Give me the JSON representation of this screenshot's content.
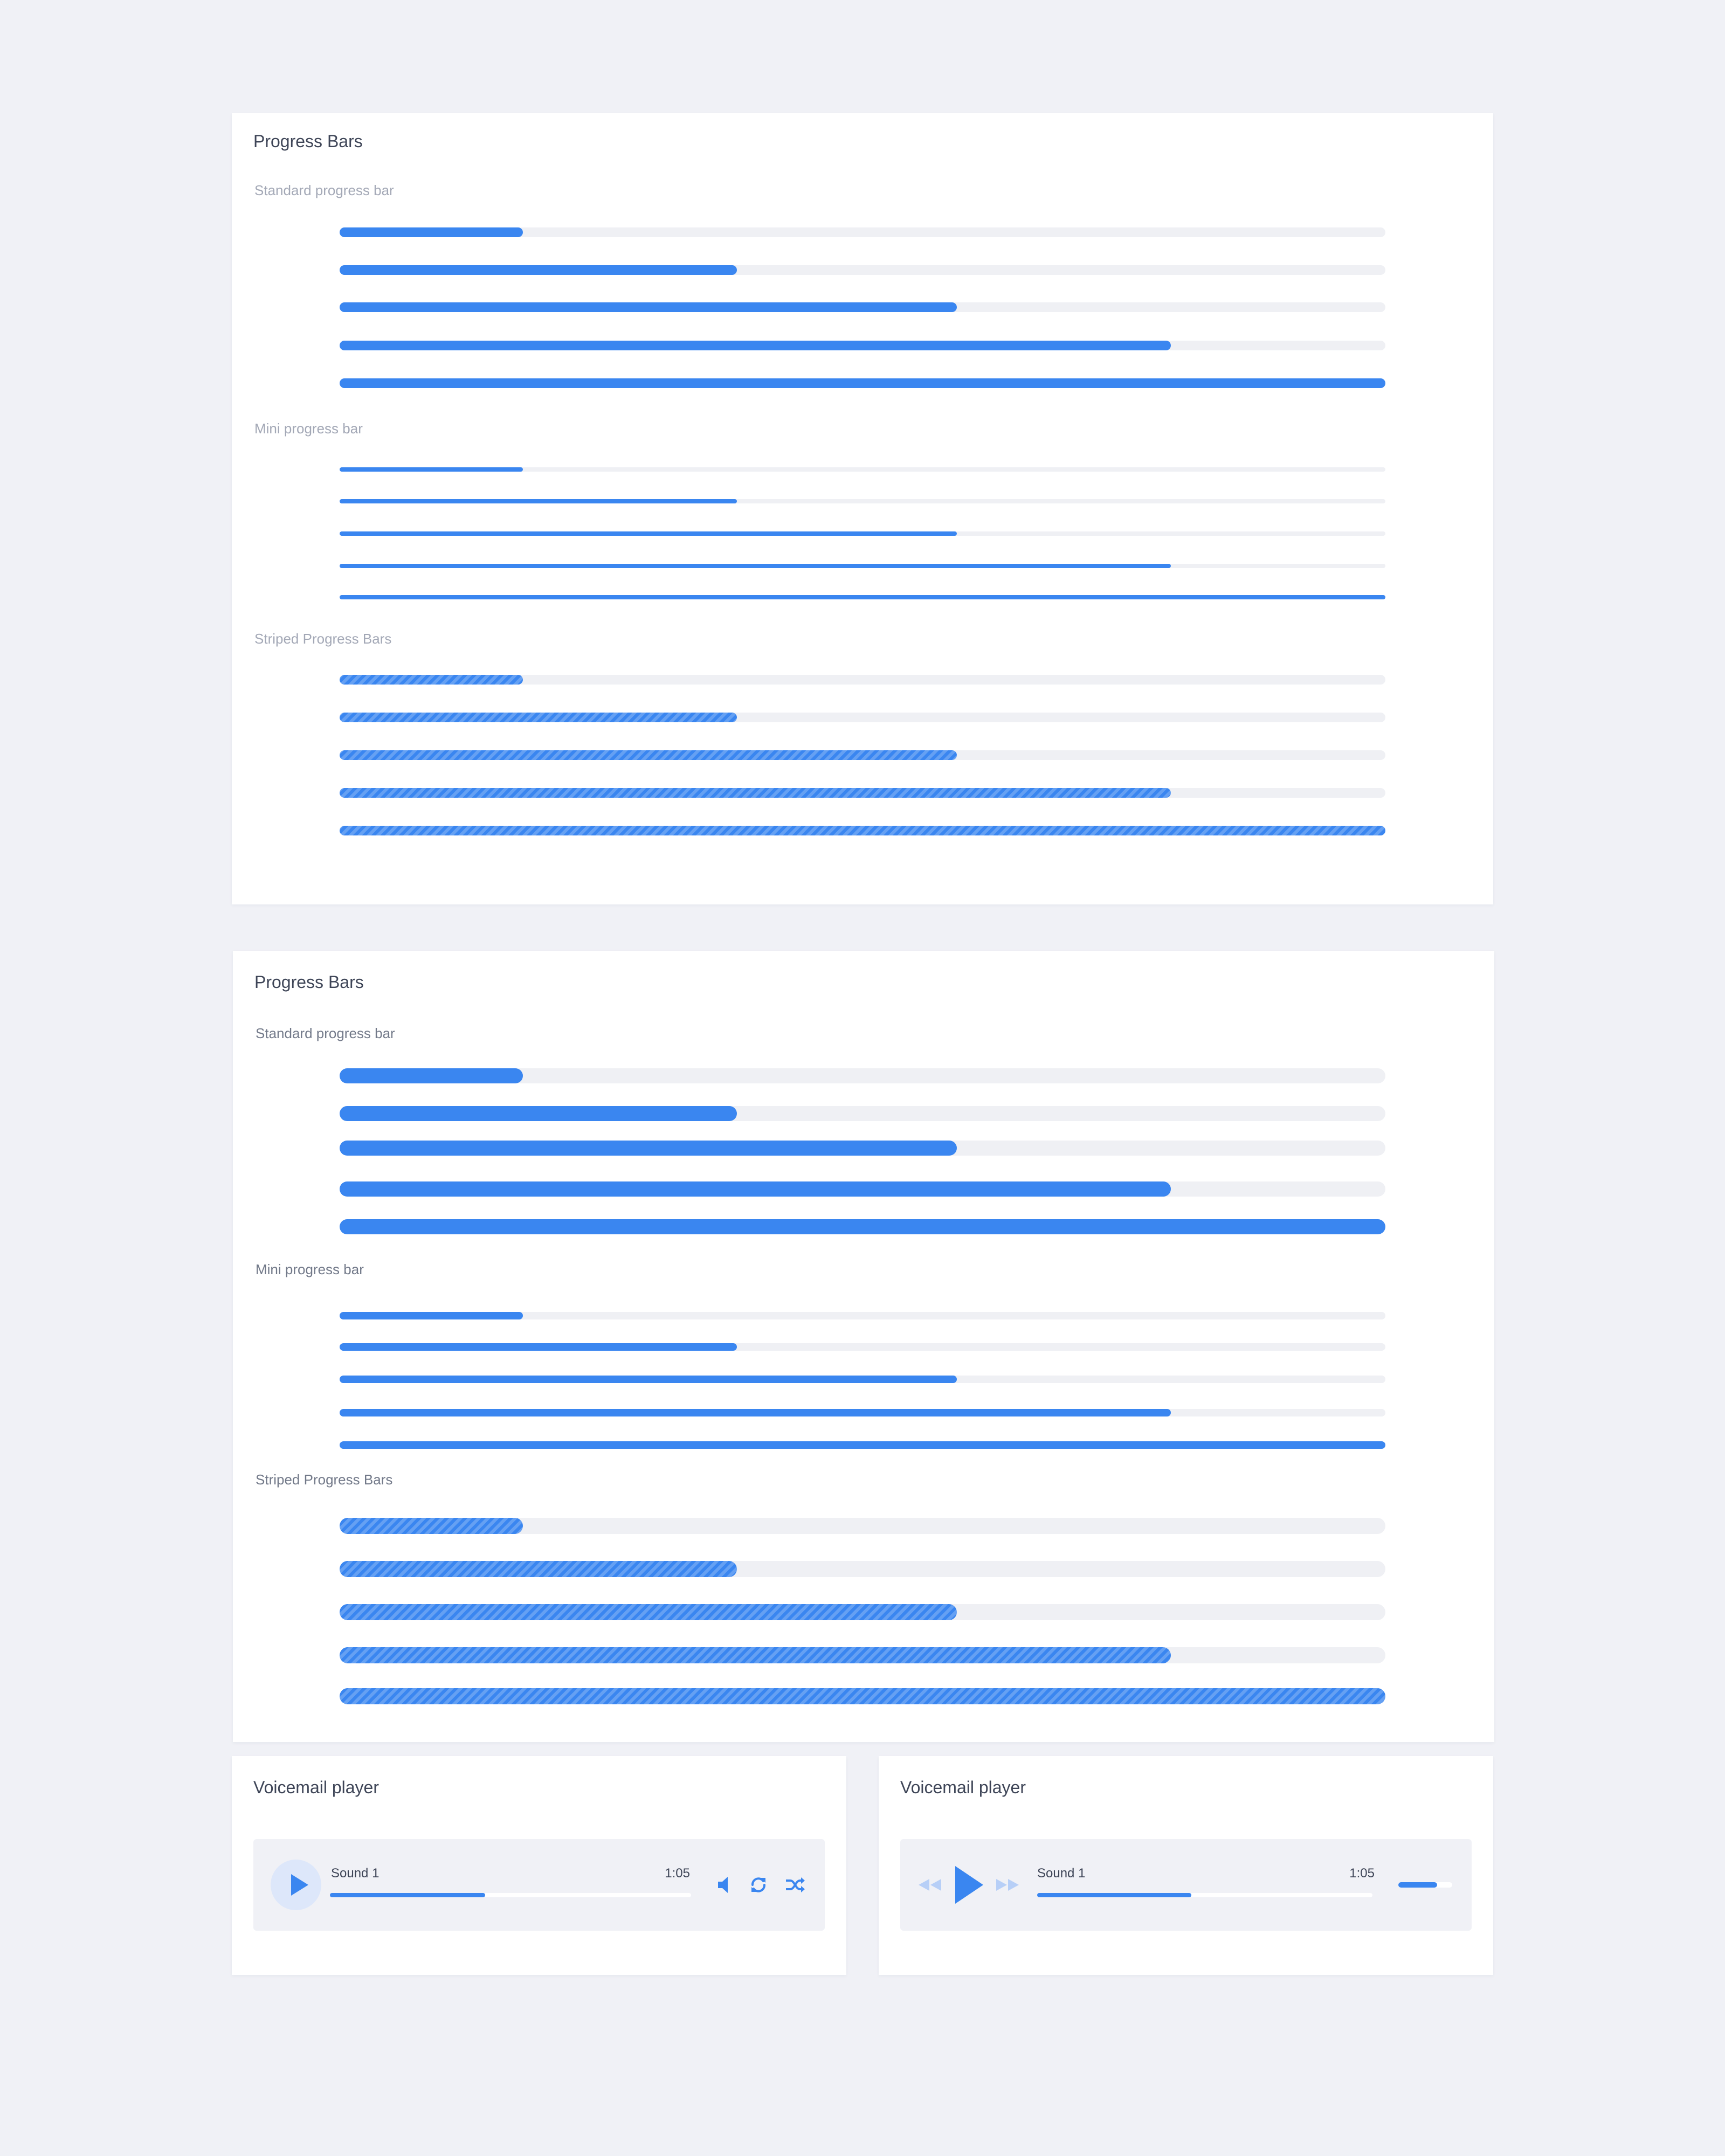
{
  "card1": {
    "title": "Progress Bars",
    "standard_label": "Standard progress bar",
    "mini_label": "Mini progress bar",
    "striped_label": "Striped Progress Bars",
    "standard_values": [
      17.5,
      38,
      59,
      79.5,
      100
    ],
    "mini_values": [
      17.5,
      38,
      59,
      79.5,
      100
    ],
    "striped_values": [
      17.5,
      38,
      59,
      79.5,
      100
    ]
  },
  "card2": {
    "title": "Progress Bars",
    "standard_label": "Standard progress bar",
    "mini_label": "Mini progress bar",
    "striped_label": "Striped Progress Bars",
    "standard_values": [
      17.5,
      38,
      59,
      79.5,
      100
    ],
    "mini_values": [
      17.5,
      38,
      59,
      79.5,
      100
    ],
    "striped_values": [
      17.5,
      38,
      59,
      79.5,
      100
    ]
  },
  "player1": {
    "title": "Voicemail player",
    "sound_name": "Sound 1",
    "duration": "1:05",
    "progress": 43,
    "icons": [
      "play-icon",
      "volume-icon",
      "repeat-icon",
      "shuffle-icon"
    ]
  },
  "player2": {
    "title": "Voicemail player",
    "sound_name": "Sound 1",
    "duration": "1:05",
    "progress": 46,
    "volume": 72,
    "icons": [
      "rewind-icon",
      "play-icon",
      "fast-forward-icon",
      "volume-slider"
    ]
  },
  "colors": {
    "accent": "#3a86f0",
    "track": "#eff0f4",
    "background": "#f0f1f6",
    "play_circle": "#dde7fa"
  }
}
